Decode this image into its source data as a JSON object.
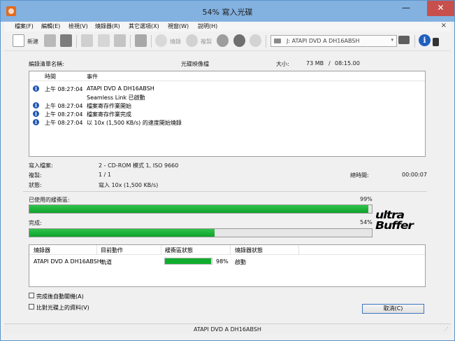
{
  "window": {
    "title": "54% 寫入光碟",
    "min_glyph": "—",
    "max_glyph": "❐",
    "close_glyph": "✕"
  },
  "menu": {
    "items": [
      "檔案(F)",
      "編輯(E)",
      "檢視(V)",
      "燒錄器(R)",
      "其它選項(X)",
      "視窗(W)",
      "說明(H)"
    ],
    "close_glyph": "×"
  },
  "toolbar": {
    "new_label": "新建",
    "burn_label": "燒錄",
    "copy_label": "複製",
    "drive": "J: ATAPI DVD A  DH16ABSH",
    "dropdown_glyph": "▾",
    "info_glyph": "i"
  },
  "summary": {
    "compilation_label": "編錄清單名稱:",
    "compilation_value": "光碟映像檔",
    "size_label": "大小:",
    "size_value": "73 MB",
    "size_sep": "/",
    "size_time": "08:15.00"
  },
  "log": {
    "col_time": "時間",
    "col_event": "事件",
    "rows": [
      {
        "icon": true,
        "time": "上午 08:27:04",
        "event": "ATAPI DVD A  DH16ABSH"
      },
      {
        "icon": false,
        "time": "",
        "event": "Seamless Link 已啟動"
      },
      {
        "icon": true,
        "time": "上午 08:27:04",
        "event": "檔案寄存作業開始"
      },
      {
        "icon": true,
        "time": "上午 08:27:04",
        "event": "檔案寄存作業完成"
      },
      {
        "icon": true,
        "time": "上午 08:27:04",
        "event": "以 10x (1,500 KB/s) 的速度開始燒錄"
      }
    ]
  },
  "details": {
    "write_mode_label": "寫入檔案:",
    "write_mode_value": "2 - CD-ROM 模式 1, ISO 9660",
    "copies_label": "複製:",
    "copies_value": "1 / 1",
    "status_label": "狀態:",
    "status_value": "寫入 10x (1,500 KB/s)",
    "total_time_label": "總時間:",
    "total_time_value": "00:00:07"
  },
  "progress": {
    "buffer_label": "已使用的緩衝區:",
    "buffer_percent_text": "99%",
    "buffer_fraction": 0.99,
    "complete_label": "完成:",
    "complete_percent_text": "54%",
    "complete_fraction": 0.54
  },
  "logo": {
    "line1": "ultra",
    "line2": "Buffer"
  },
  "drives": {
    "col_recorder": "燒錄器",
    "col_action": "目前動作",
    "col_buffer": "緩衝區狀態",
    "col_status": "燒錄器狀態",
    "rows": [
      {
        "recorder": "ATAPI DVD A  DH16ABSH",
        "action": "軌道",
        "buffer_fraction": 0.98,
        "buffer_text": "98%",
        "status": "啟動"
      }
    ]
  },
  "options": {
    "shutdown_label": "完成後自動關機(A)",
    "verify_label": "比對光碟上的資料(V)"
  },
  "actions": {
    "cancel_label": "取消(C)"
  },
  "statusbar": {
    "text": "ATAPI   DVD A  DH16ABSH",
    "grip_glyph": "⋰"
  },
  "colors": {
    "progress_green": "#12ad30",
    "titlebar": "#83b1e0",
    "close_red": "#c7504c",
    "info_blue": "#2157b0"
  }
}
